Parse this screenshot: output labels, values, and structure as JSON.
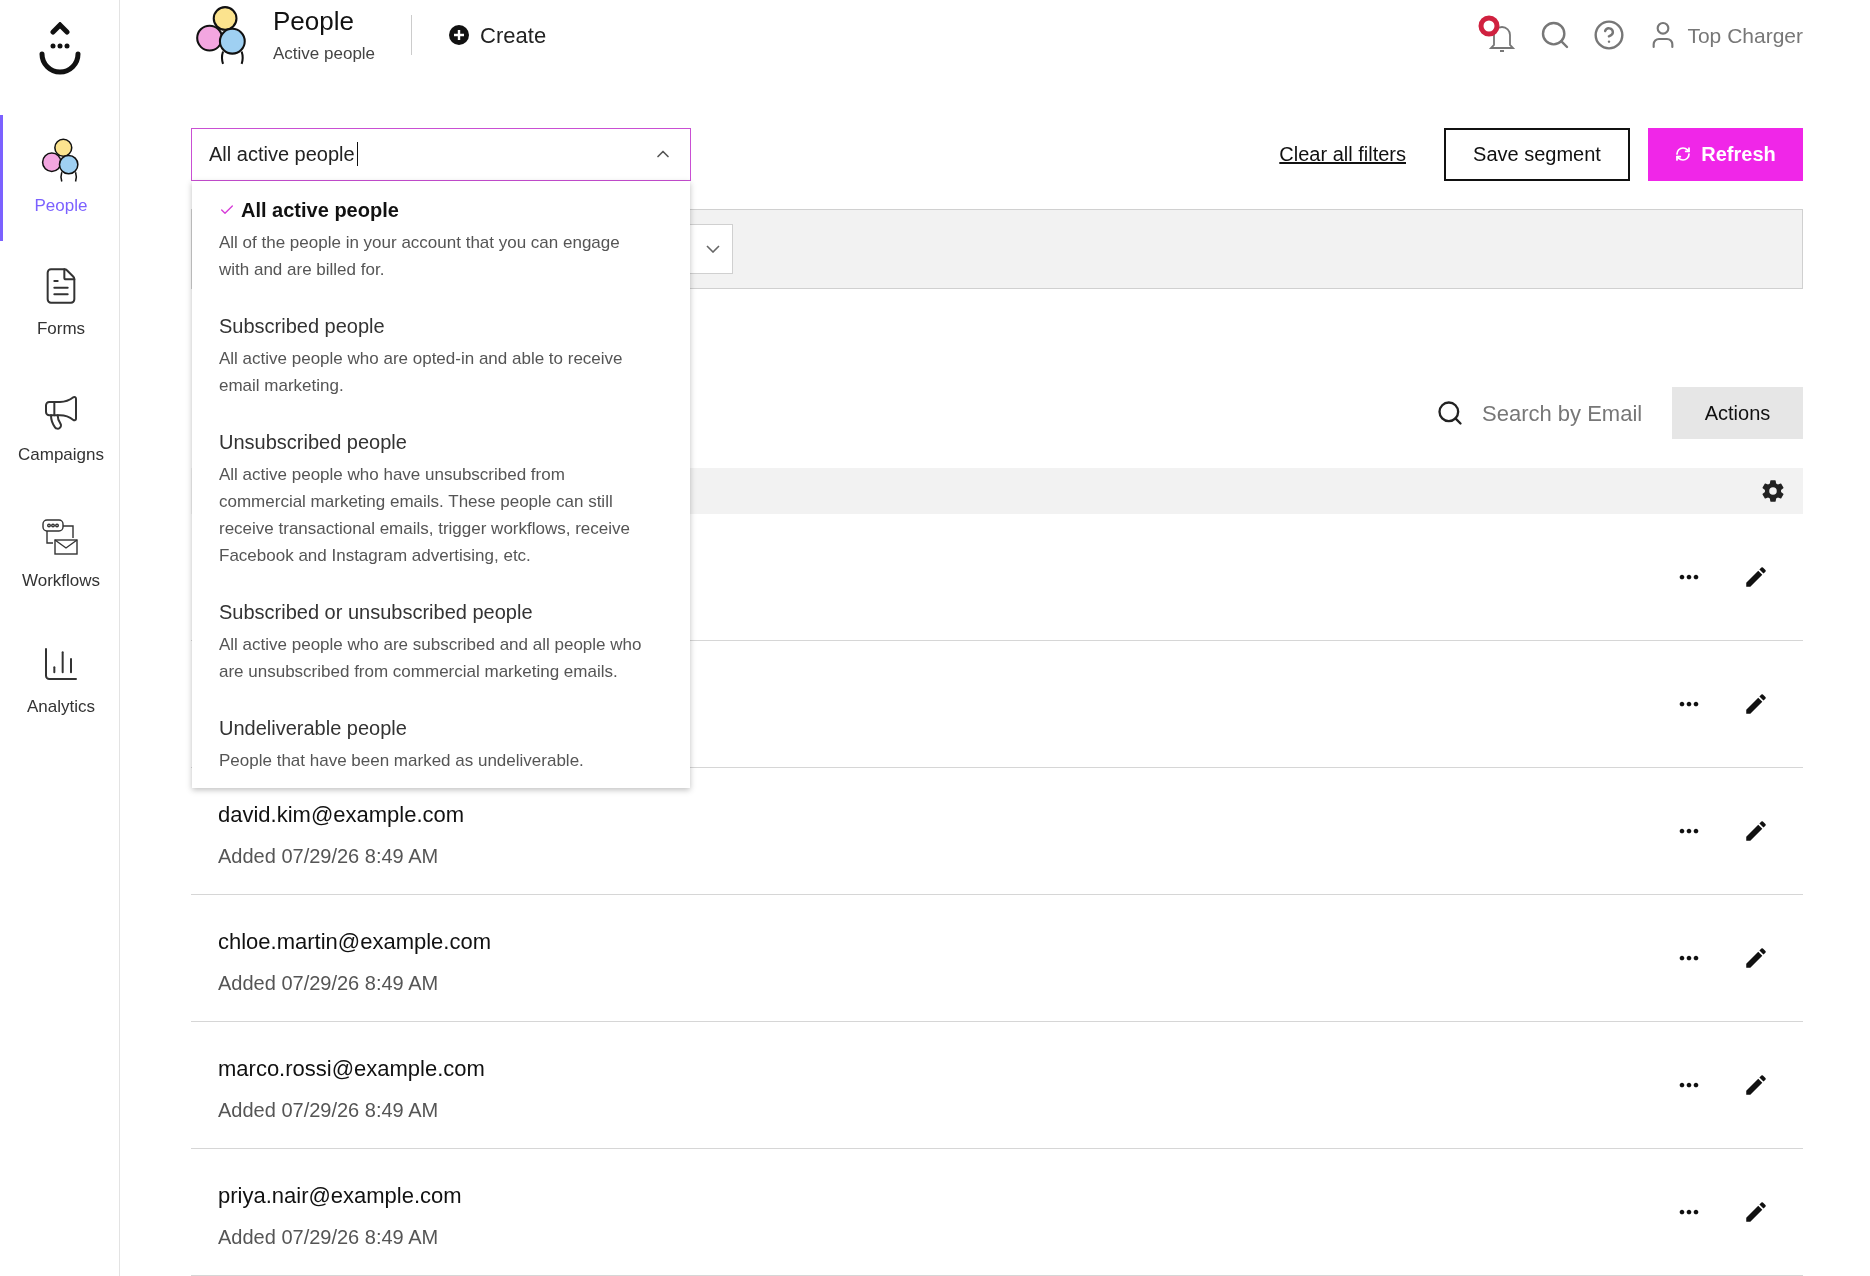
{
  "sidebar": {
    "items": [
      {
        "label": "People",
        "kind": "people",
        "selected": true
      },
      {
        "label": "Forms",
        "kind": "forms",
        "selected": false
      },
      {
        "label": "Campaigns",
        "kind": "campaigns",
        "selected": false
      },
      {
        "label": "Workflows",
        "kind": "workflows",
        "selected": false
      },
      {
        "label": "Analytics",
        "kind": "analytics",
        "selected": false
      }
    ]
  },
  "header": {
    "title": "People",
    "subtitle": "Active people",
    "create": "Create",
    "user": "Top Charger"
  },
  "filter": {
    "value": "All active people",
    "expanded": true,
    "options": [
      {
        "label": "All active people",
        "description": "All of the people in your account that you can engage with and are billed for.",
        "selected": true
      },
      {
        "label": "Subscribed people",
        "description": "All active people who are opted-in and able to receive email marketing.",
        "selected": false
      },
      {
        "label": "Unsubscribed people",
        "description": "All active people who have unsubscribed from commercial marketing emails. These people can still receive transactional emails, trigger workflows, receive Facebook and Instagram advertising, etc.",
        "selected": false
      },
      {
        "label": "Subscribed or unsubscribed people",
        "description": "All active people who are subscribed and all people who are unsubscribed from commercial marketing emails.",
        "selected": false
      },
      {
        "label": "Undeliverable people",
        "description": "People that have been marked as undeliverable.",
        "selected": false
      }
    ]
  },
  "clear_filters": "Clear all filters",
  "save_segment": "Save segment",
  "refresh": "Refresh",
  "search": {
    "placeholder": "Search by Email"
  },
  "actions": "Actions",
  "rows": [
    {
      "kind": "covered"
    },
    {
      "kind": "covered"
    },
    {
      "kind": "contact",
      "email": "david.kim@example.com",
      "added": "Added 07/29/26 8:49 AM"
    },
    {
      "kind": "contact",
      "email": "chloe.martin@example.com",
      "added": "Added 07/29/26 8:49 AM"
    },
    {
      "kind": "contact",
      "email": "marco.rossi@example.com",
      "added": "Added 07/29/26 8:49 AM"
    },
    {
      "kind": "contact",
      "email": "priya.nair@example.com",
      "added": "Added 07/29/26 8:49 AM"
    }
  ]
}
